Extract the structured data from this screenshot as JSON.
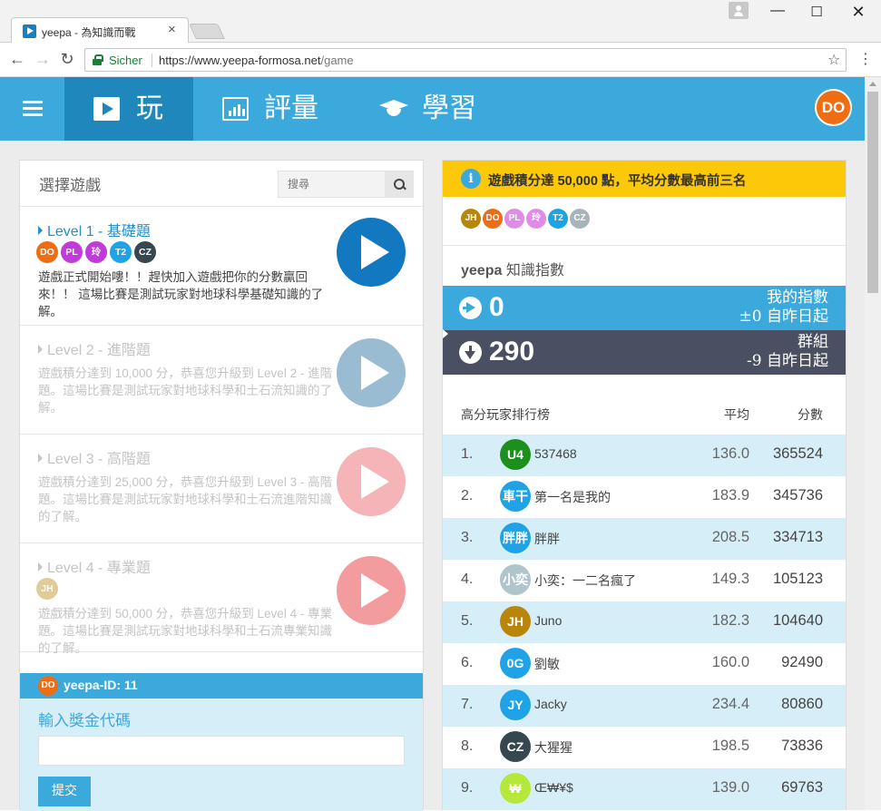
{
  "browser": {
    "tab_title": "yeepa - 為知識而戰",
    "secure_label": "Sicher",
    "url_host": "https://www.yeepa-formosa.net",
    "url_path": "/game"
  },
  "nav": {
    "items": [
      {
        "label": "玩",
        "icon": "play-icon",
        "active": true
      },
      {
        "label": "評量",
        "icon": "bar-chart-icon",
        "active": false
      },
      {
        "label": "學習",
        "icon": "graduation-cap-icon",
        "active": false
      }
    ],
    "user_initials": "DO",
    "user_color": "#ee6d12"
  },
  "game_select": {
    "title": "選擇遊戲",
    "search_placeholder": "搜尋",
    "levels": [
      {
        "title": "Level 1 - 基礎題",
        "description": "遊戲正式開始嘍！！趕快加入遊戲把你的分數贏回來！！ 這場比賽是測試玩家對地球科學基礎知識的了解。",
        "players": [
          {
            "initials": "DO",
            "color": "#ee6d12"
          },
          {
            "initials": "PL",
            "color": "#c03bd9"
          },
          {
            "initials": "玲",
            "color": "#c03bd9"
          },
          {
            "initials": "T2",
            "color": "#1fa3e6"
          },
          {
            "initials": "CZ",
            "color": "#37474f"
          }
        ],
        "play_color": "#1279c0"
      },
      {
        "title": "Level 2 - 進階題",
        "description": "遊戲積分達到 10,000 分，恭喜您升級到 Level 2 - 進階題。這場比賽是測試玩家對地球科學和土石流知識的了解。",
        "players": [],
        "play_color": "#99bcd3"
      },
      {
        "title": "Level 3 - 高階題",
        "description": "遊戲積分達到 25,000 分，恭喜您升級到 Level 3 - 高階題。這場比賽是測試玩家對地球科學和土石流進階知識的了解。",
        "players": [],
        "play_color": "#f5b4b7"
      },
      {
        "title": "Level 4 - 專業題",
        "description": "遊戲積分達到 50,000 分，恭喜您升級到 Level 4 - 專業題。這場比賽是測試玩家對地球科學和土石流專業知識的了解。",
        "players": [
          {
            "initials": "JH",
            "color": "#e0cc98"
          }
        ],
        "play_color": "#f29c9e"
      }
    ],
    "yeepa_id": "yeepa-ID: 11",
    "bonus_label": "輸入獎金代碼",
    "bonus_value": "",
    "submit_label": "提交"
  },
  "stats": {
    "notice": "遊戲積分達 50,000 點，平均分數最高前三名",
    "top_players": [
      {
        "initials": "JH",
        "color": "#b8860b"
      },
      {
        "initials": "DO",
        "color": "#ee6d12"
      },
      {
        "initials": "PL",
        "color": "#e08be8"
      },
      {
        "initials": "玲",
        "color": "#e08be8"
      },
      {
        "initials": "T2",
        "color": "#1fa3e6"
      },
      {
        "initials": "CZ",
        "color": "#a7b4ba"
      }
    ],
    "index_title_brand": "yeepa",
    "index_title": "知識指數",
    "my_index": {
      "value": "0",
      "label": "我的指數",
      "change": "±0 自昨日起",
      "color": "#3ba9dc"
    },
    "group_index": {
      "value": "290",
      "label": "群組",
      "change": "-9 自昨日起",
      "color": "#4a5061"
    },
    "leaderboard": {
      "title": "高分玩家排行榜",
      "avg_header": "平均",
      "score_header": "分數",
      "rows": [
        {
          "rank": "1.",
          "initials": "U4",
          "color": "#1c8f1c",
          "name": "537468",
          "avg": "136.0",
          "score": "365524"
        },
        {
          "rank": "2.",
          "initials": "車干",
          "color": "#1fa3e6",
          "name": "第一名是我的",
          "avg": "183.9",
          "score": "345736"
        },
        {
          "rank": "3.",
          "initials": "胖胖",
          "color": "#1fa3e6",
          "name": "胖胖",
          "avg": "208.5",
          "score": "334713"
        },
        {
          "rank": "4.",
          "initials": "小奕",
          "color": "#b0c4cc",
          "name": "小奕：一二名瘋了",
          "avg": "149.3",
          "score": "105123"
        },
        {
          "rank": "5.",
          "initials": "JH",
          "color": "#b8860b",
          "name": "Juno",
          "avg": "182.3",
          "score": "104640"
        },
        {
          "rank": "6.",
          "initials": "0G",
          "color": "#1fa3e6",
          "name": "劉敏",
          "avg": "160.0",
          "score": "92490"
        },
        {
          "rank": "7.",
          "initials": "JY",
          "color": "#1fa3e6",
          "name": "Jacky",
          "avg": "234.4",
          "score": "80860"
        },
        {
          "rank": "8.",
          "initials": "CZ",
          "color": "#37474f",
          "name": "大猩猩",
          "avg": "198.5",
          "score": "73836"
        },
        {
          "rank": "9.",
          "initials": "₩",
          "color": "#b5e83a",
          "name": "Œ₩¥$",
          "avg": "139.0",
          "score": "69763"
        }
      ]
    }
  }
}
